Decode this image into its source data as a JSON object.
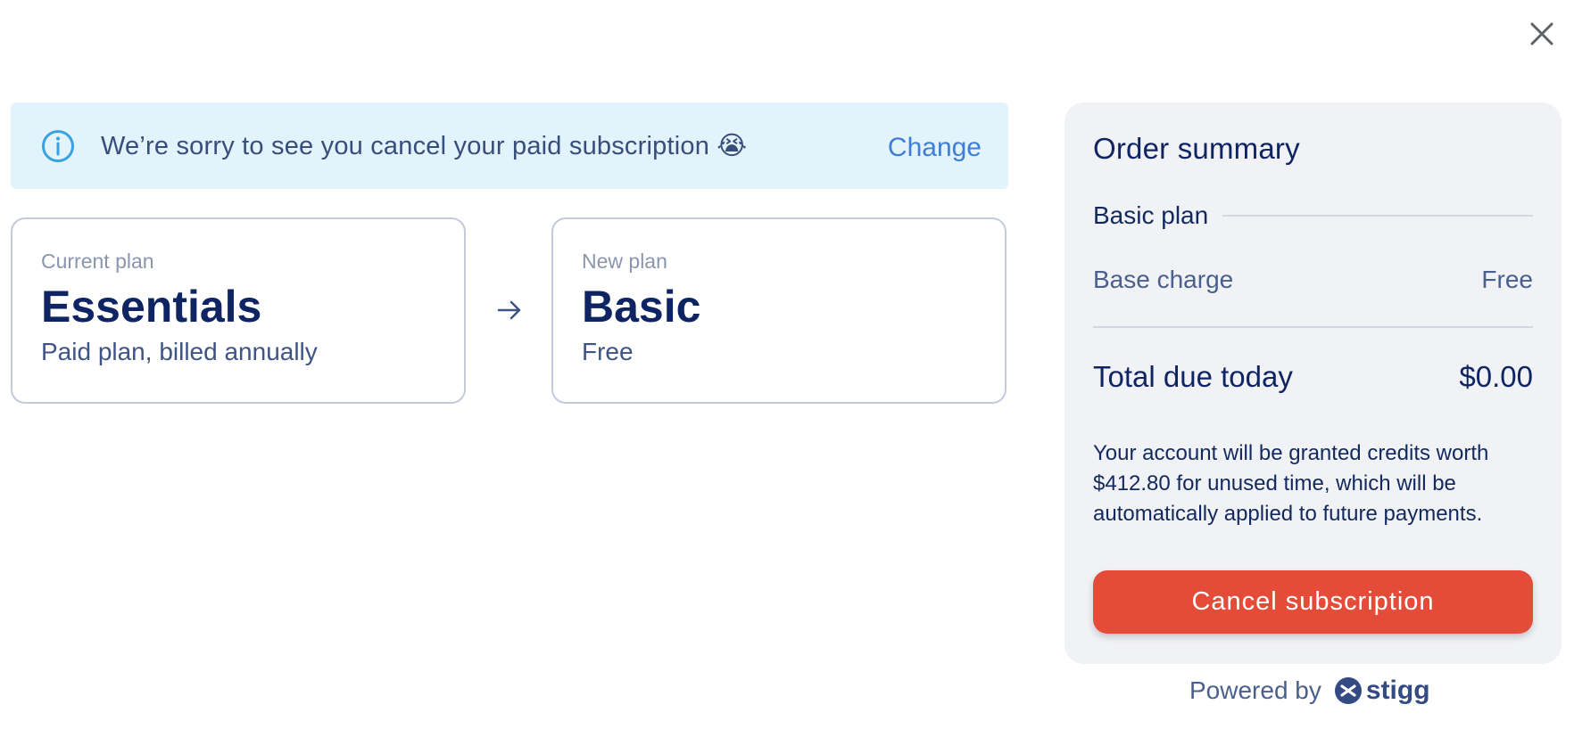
{
  "dialog": {
    "close_icon": "close-icon"
  },
  "banner": {
    "icon": "info-circle-icon",
    "message": "We’re sorry to see you cancel your paid subscription 😭",
    "change_label": "Change"
  },
  "current_plan": {
    "label": "Current plan",
    "name": "Essentials",
    "description": "Paid plan, billed annually"
  },
  "transition_icon": "arrow-right-icon",
  "new_plan": {
    "label": "New plan",
    "name": "Basic",
    "description": "Free"
  },
  "order_summary": {
    "title": "Order summary",
    "plan_name": "Basic plan",
    "base_charge_label": "Base charge",
    "base_charge_value": "Free",
    "total_label": "Total due today",
    "total_value": "$0.00",
    "credits_note": "Your account will be granted credits worth $412.80 for unused time, which will be automatically applied to future payments.",
    "cancel_button_label": "Cancel subscription"
  },
  "footer": {
    "powered_by": "Powered by",
    "brand_icon": "stigg-logo-icon",
    "brand_name": "stigg"
  },
  "colors": {
    "banner_bg": "#e3f3fb",
    "accent_blue": "#3d7fd6",
    "cancel_button": "#e44b38",
    "navy_text": "#0f2462",
    "summary_bg": "#f1f2f6"
  }
}
